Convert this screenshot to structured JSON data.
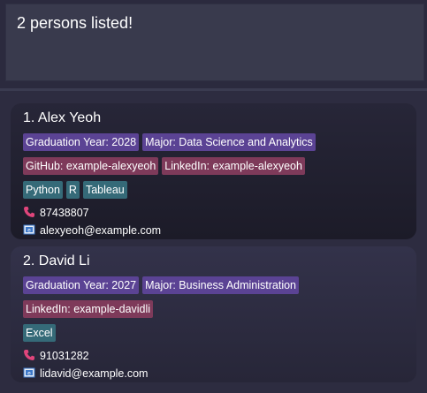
{
  "result": {
    "message": "2 persons listed!"
  },
  "persons": [
    {
      "index_name": "1. Alex Yeoh",
      "tags_row1": [
        "Graduation Year: 2028",
        "Major: Data Science and Analytics"
      ],
      "tags_row2": [
        "GitHub: example-alexyeoh",
        "LinkedIn: example-alexyeoh"
      ],
      "skills": [
        "Python",
        "R",
        "Tableau"
      ],
      "phone": "87438807",
      "email": "alexyeoh@example.com"
    },
    {
      "index_name": "2. David Li",
      "tags_row1": [
        "Graduation Year: 2027",
        "Major: Business Administration"
      ],
      "tags_row2": [
        "LinkedIn: example-davidli"
      ],
      "skills": [
        "Excel"
      ],
      "phone": "91031282",
      "email": "lidavid@example.com"
    }
  ],
  "colors": {
    "background": "#2b2a3e",
    "tag_purple": "#5b4394",
    "tag_pink": "#7e3a5a",
    "tag_teal": "#356a78",
    "phone_icon": "#e0457b",
    "email_icon": "#3d78c9"
  },
  "icons": {
    "phone": "phone-icon",
    "email": "email-icon"
  }
}
